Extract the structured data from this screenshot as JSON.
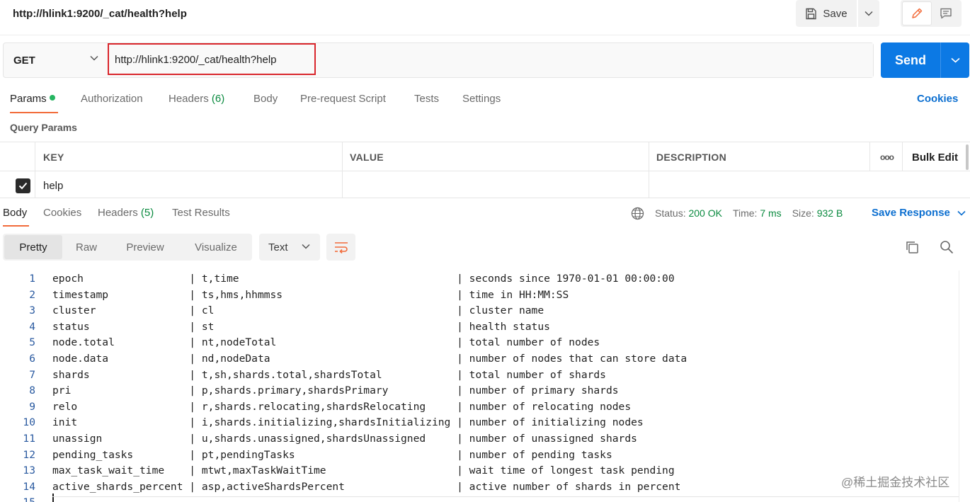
{
  "request": {
    "title": "http://hlink1:9200/_cat/health?help",
    "save_label": "Save",
    "method": "GET",
    "url": "http://hlink1:9200/_cat/health?help",
    "send_label": "Send"
  },
  "request_tabs": {
    "params": "Params",
    "authorization": "Authorization",
    "headers": "Headers",
    "headers_count": "(6)",
    "body": "Body",
    "prerequest": "Pre-request Script",
    "tests": "Tests",
    "settings": "Settings",
    "cookies": "Cookies"
  },
  "query_params": {
    "label": "Query Params",
    "headers": {
      "key": "KEY",
      "value": "VALUE",
      "description": "DESCRIPTION",
      "more": "ooo",
      "bulk_edit": "Bulk Edit"
    },
    "rows": [
      {
        "checked": true,
        "key": "help",
        "value": "",
        "description": ""
      }
    ]
  },
  "response_tabs": {
    "body": "Body",
    "cookies": "Cookies",
    "headers": "Headers",
    "headers_count": "(5)",
    "test_results": "Test Results"
  },
  "response_status": {
    "status_label": "Status:",
    "status_value": "200 OK",
    "time_label": "Time:",
    "time_value": "7 ms",
    "size_label": "Size:",
    "size_value": "932 B",
    "save_response": "Save Response"
  },
  "response_toolbar": {
    "views": [
      "Pretty",
      "Raw",
      "Preview",
      "Visualize"
    ],
    "active_view": "Pretty",
    "format": "Text"
  },
  "response_body": {
    "lines": [
      "epoch                 | t,time                                   | seconds since 1970-01-01 00:00:00",
      "timestamp             | ts,hms,hhmmss                            | time in HH:MM:SS",
      "cluster               | cl                                       | cluster name",
      "status                | st                                       | health status",
      "node.total            | nt,nodeTotal                             | total number of nodes",
      "node.data             | nd,nodeData                              | number of nodes that can store data",
      "shards                | t,sh,shards.total,shardsTotal            | total number of shards",
      "pri                   | p,shards.primary,shardsPrimary           | number of primary shards",
      "relo                  | r,shards.relocating,shardsRelocating     | number of relocating nodes",
      "init                  | i,shards.initializing,shardsInitializing | number of initializing nodes",
      "unassign              | u,shards.unassigned,shardsUnassigned     | number of unassigned shards",
      "pending_tasks         | pt,pendingTasks                          | number of pending tasks",
      "max_task_wait_time    | mtwt,maxTaskWaitTime                     | wait time of longest task pending",
      "active_shards_percent | asp,activeShardsPercent                  | active number of shards in percent",
      ""
    ]
  },
  "watermark": "@稀土掘金技术社区",
  "colors": {
    "accent": "#f26b3a",
    "send": "#0c79e4",
    "link": "#0c6fd0",
    "success": "#0a8a3f",
    "highlight_border": "#d9262c"
  }
}
